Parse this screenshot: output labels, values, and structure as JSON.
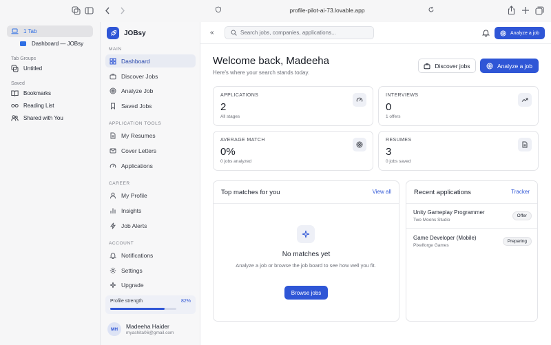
{
  "browser": {
    "url": "profile-pilot-ai-73.lovable.app",
    "sidebar": {
      "tab_count_label": "1 Tab",
      "tab_item": "Dashboard — JOBsy",
      "tab_groups_header": "Tab Groups",
      "untitled_group": "Untitled",
      "saved_header": "Saved",
      "bookmarks": "Bookmarks",
      "reading_list": "Reading List",
      "shared_with_you": "Shared with You"
    }
  },
  "app": {
    "brand": "JOBsy",
    "sections": [
      {
        "header": "MAIN",
        "items": [
          {
            "label": "Dashboard",
            "icon": "grid-icon",
            "active": true
          },
          {
            "label": "Discover Jobs",
            "icon": "briefcase-icon"
          },
          {
            "label": "Analyze Job",
            "icon": "target-icon"
          },
          {
            "label": "Saved Jobs",
            "icon": "bookmark-icon"
          }
        ]
      },
      {
        "header": "APPLICATION TOOLS",
        "items": [
          {
            "label": "My Resumes",
            "icon": "document-icon"
          },
          {
            "label": "Cover Letters",
            "icon": "mail-icon"
          },
          {
            "label": "Applications",
            "icon": "gauge-icon"
          }
        ]
      },
      {
        "header": "CAREER",
        "items": [
          {
            "label": "My Profile",
            "icon": "user-icon"
          },
          {
            "label": "Insights",
            "icon": "chart-icon"
          },
          {
            "label": "Job Alerts",
            "icon": "bolt-icon"
          }
        ]
      },
      {
        "header": "ACCOUNT",
        "items": [
          {
            "label": "Notifications",
            "icon": "bell-icon"
          },
          {
            "label": "Settings",
            "icon": "gear-icon"
          },
          {
            "label": "Upgrade",
            "icon": "sparkle-icon"
          }
        ]
      }
    ],
    "profile_strength": {
      "label": "Profile strength",
      "value_text": "82%",
      "percent": 82
    },
    "user": {
      "initials": "MH",
      "name": "Madeeha Haider",
      "email": "myashita06@gmail.com"
    }
  },
  "header": {
    "search_placeholder": "Search jobs, companies, applications...",
    "analyze_button": "Analyze a job"
  },
  "main": {
    "welcome": "Welcome back, Madeeha",
    "subtitle": "Here's where your search stands today.",
    "discover_button": "Discover jobs",
    "analyze_button": "Analyze a job",
    "stats": [
      {
        "label": "APPLICATIONS",
        "value": "2",
        "sub": "All stages",
        "icon": "gauge-icon"
      },
      {
        "label": "INTERVIEWS",
        "value": "0",
        "sub": "1 offers",
        "icon": "trend-up-icon"
      },
      {
        "label": "AVERAGE MATCH",
        "value": "0%",
        "sub": "0 jobs analyzed",
        "icon": "target-icon"
      },
      {
        "label": "RESUMES",
        "value": "3",
        "sub": "0 jobs saved",
        "icon": "document-icon"
      }
    ],
    "top_matches": {
      "title": "Top matches for you",
      "link": "View all",
      "empty_title": "No matches yet",
      "empty_text": "Analyze a job or browse the job board to see how well you fit.",
      "button": "Browse jobs"
    },
    "recent": {
      "title": "Recent applications",
      "link": "Tracker",
      "items": [
        {
          "title": "Unity Gameplay Programmer",
          "company": "Two Moons Studio",
          "status": "Offer"
        },
        {
          "title": "Game Developer (Mobile)",
          "company": "Pixelforge Games",
          "status": "Preparing"
        }
      ]
    }
  },
  "colors": {
    "accent": "#2f56d6",
    "sidebar_bg": "#f7f7f8",
    "browser_chrome": "#f6f6f7"
  }
}
